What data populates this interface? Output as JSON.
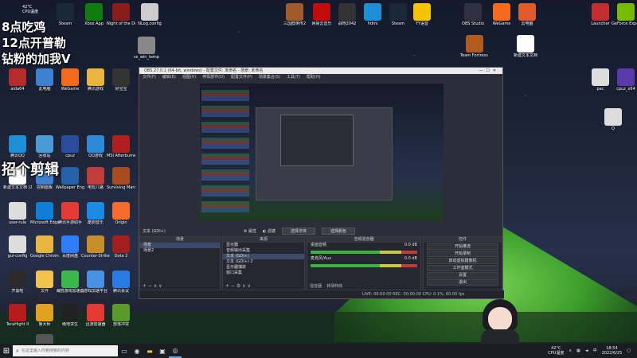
{
  "overlay": {
    "line1": "8点吃鸡",
    "line2": "12点开普勒",
    "line3": "钻粉的加我V",
    "line4": "招个剪辑"
  },
  "widget": {
    "temp": "42°C",
    "label": "CPU温度"
  },
  "desktop_icons": [
    {
      "label": "Steam",
      "color": "#1b2838"
    },
    {
      "label": "Xbox App",
      "color": "#107c10"
    },
    {
      "label": "Night of the Dead",
      "color": "#8a1c1c"
    },
    {
      "label": "NLog.config",
      "color": "#cccccc"
    },
    {
      "label": "三国群英传2",
      "color": "#a05a2c"
    },
    {
      "label": "网易云音乐",
      "color": "#c20c0c"
    },
    {
      "label": "战地2042",
      "color": "#333333"
    },
    {
      "label": "hdmi",
      "color": "#1e8fd6"
    },
    {
      "label": "Steam",
      "color": "#1b2838"
    },
    {
      "label": "YY语音",
      "color": "#f5c400"
    },
    {
      "label": "OBS Studio",
      "color": "#303040"
    },
    {
      "label": "WeGame",
      "color": "#f26a1b"
    },
    {
      "label": "云电脑",
      "color": "#e05a2a"
    },
    {
      "label": "Launcher",
      "color": "#c22e2e"
    },
    {
      "label": "GeForce Experience",
      "color": "#76b900"
    },
    {
      "label": "aida64",
      "color": "#b52b2b"
    },
    {
      "label": "此电脑",
      "color": "#3f7fd0"
    },
    {
      "label": "WeGame",
      "color": "#f26a1b"
    },
    {
      "label": "腾讯游戏",
      "color": "#e8b640"
    },
    {
      "label": "好宝宝",
      "color": "#333333"
    },
    {
      "label": "ss_win_temp",
      "color": "#888888"
    },
    {
      "label": "Team Fortress 2",
      "color": "#b35a1f"
    },
    {
      "label": "新建文本文档",
      "color": "#ffffff"
    },
    {
      "label": "腾讯QQ",
      "color": "#1e8fd6"
    },
    {
      "label": "回收站",
      "color": "#4a9ad6"
    },
    {
      "label": "cpuz",
      "color": "#2a4c9a"
    },
    {
      "label": "QQ游戏",
      "color": "#2e8ad8"
    },
    {
      "label": "MSI Afterburner",
      "color": "#b01e1e"
    },
    {
      "label": "pac",
      "color": "#dddddd"
    },
    {
      "label": "cpuz_x64",
      "color": "#5a3aa8"
    },
    {
      "label": "Q",
      "color": "#dddddd"
    },
    {
      "label": "新建文本文档 (2)",
      "color": "#ffffff"
    },
    {
      "label": "控制面板",
      "color": "#3f7fd0"
    },
    {
      "label": "Wallpaper Engine",
      "color": "#2660a8"
    },
    {
      "label": "电玩八路",
      "color": "#c23b3b"
    },
    {
      "label": "Surviving Mars",
      "color": "#a84b1e"
    },
    {
      "label": "user-rule",
      "color": "#dddddd"
    },
    {
      "label": "Microsoft Edge",
      "color": "#0f7ed6"
    },
    {
      "label": "腾讯手游助手",
      "color": "#e53935"
    },
    {
      "label": "酷狗音乐",
      "color": "#1e88e5"
    },
    {
      "label": "Origin",
      "color": "#f56c2d"
    },
    {
      "label": "gui-config",
      "color": "#dddddd"
    },
    {
      "label": "Google Chrome",
      "color": "#e8b640"
    },
    {
      "label": "百度网盘",
      "color": "#2f7cf6"
    },
    {
      "label": "Counter-Strike Global Off",
      "color": "#c78d2a"
    },
    {
      "label": "Dota 2",
      "color": "#a51e1e"
    },
    {
      "label": "开黑啦",
      "color": "#2a2a2a"
    },
    {
      "label": "文件",
      "color": "#f2c14e"
    },
    {
      "label": "海鸥游戏加速器",
      "color": "#3cb84b"
    },
    {
      "label": "游戏加速平台",
      "color": "#4a90e2"
    },
    {
      "label": "腾讯会议",
      "color": "#2a7ae2"
    },
    {
      "label": "TeraHight II",
      "color": "#b71c1c"
    },
    {
      "label": "鲁大师",
      "color": "#e0a020"
    },
    {
      "label": "绝地求生",
      "color": "#222222"
    },
    {
      "label": "迅游加速器",
      "color": "#e53935"
    },
    {
      "label": "部落冲突",
      "color": "#5a9a2a"
    },
    {
      "label": "ARK Survival Evolved",
      "color": "#555555"
    }
  ],
  "obs": {
    "title": "OBS 27.0.1 (64-bit, windows) - 配置文件: 未命名 - 场景: 未命名",
    "menu": [
      "文件(F)",
      "编辑(E)",
      "视图(V)",
      "停靠部件(D)",
      "配置文件(P)",
      "场景集合(S)",
      "工具(T)",
      "帮助(H)"
    ],
    "source_name": "文本 (GDI+)",
    "props_btn": "属性",
    "filters_btn": "滤镜",
    "select_font": "选择字体",
    "select_color": "选择颜色",
    "docks": {
      "scenes": {
        "title": "场景",
        "items": [
          "场景",
          "场景2"
        ]
      },
      "sources": {
        "title": "来源",
        "items": [
          "显示器",
          "音频输出采集",
          "文本 (GDI+)",
          "文本 (GDI+) 2",
          "显示器捕获",
          "窗口采集"
        ]
      },
      "mixer": {
        "title": "音频混音器",
        "tracks": [
          "桌面音频",
          "麦克风/Aux"
        ],
        "levels": [
          "0.0 dB",
          "0.0 dB"
        ],
        "tabs": [
          "混音器",
          "转场特效"
        ]
      },
      "controls": {
        "title": "控件",
        "buttons": [
          "开始推流",
          "开始录制",
          "启动虚拟摄像机",
          "工作室模式",
          "设置",
          "退出"
        ]
      }
    },
    "status": "LIVE: 00:00:00   REC: 00:00:00   CPU: 0.1%, 60.00 fps"
  },
  "taskbar": {
    "search_placeholder": "在这里输入你要搜索的内容",
    "weather": "42°C",
    "weather_label": "CPU温度",
    "time": "18:54",
    "date": "2022/6/25",
    "lang": "中"
  }
}
